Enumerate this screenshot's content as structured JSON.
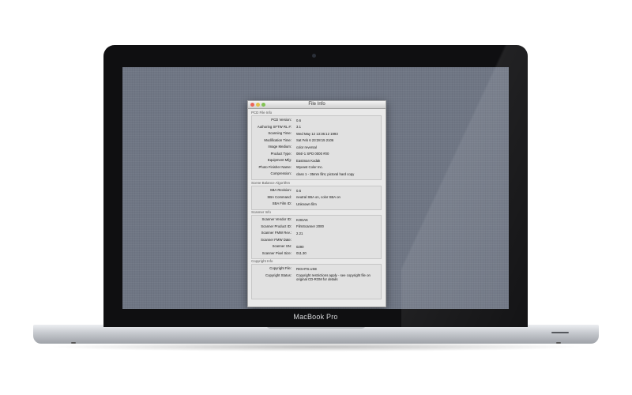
{
  "device": {
    "brand": "MacBook Pro"
  },
  "window": {
    "title": "File Info",
    "groups": {
      "pcd": {
        "label": "PCD File Info",
        "rows": [
          {
            "key": "PCD Version:",
            "value": "0.6"
          },
          {
            "key": "Authoring SFTW RL #:",
            "value": "3.1"
          },
          {
            "key": "Scanning Time:",
            "value": "Wed May 12 13:36:12 1993"
          },
          {
            "key": "Modification Time:",
            "value": "Sat Feb  6 23:28:15 2106"
          },
          {
            "key": "Image Medium:",
            "value": "color reversal"
          },
          {
            "key": "Product Type:",
            "value": "084/-1 SPD 0000 #00"
          },
          {
            "key": "Equipment Mfg:",
            "value": "Eastman Kodak"
          },
          {
            "key": "Photo Finisher Name:",
            "value": "Wyeast Color Inc."
          },
          {
            "key": "Compression:",
            "value": "class 1 - 35mm film; pictoral hard copy"
          }
        ]
      },
      "sba": {
        "label": "Scene Balance Algorithm",
        "rows": [
          {
            "key": "SBA Revision:",
            "value": "0.6"
          },
          {
            "key": "SBA Command:",
            "value": "neutral SBA on, color SBA on"
          },
          {
            "key": "SBA Film ID:",
            "value": "Unknown film"
          }
        ]
      },
      "scanner": {
        "label": "Scanner Info",
        "rows": [
          {
            "key": "Scanner Vendor ID:",
            "value": "KODAK"
          },
          {
            "key": "Scanner Product ID:",
            "value": "FilmScanner 2000"
          },
          {
            "key": "Scanner FMW Rev.:",
            "value": "2.21"
          },
          {
            "key": "Scanner FMW Date:",
            "value": ""
          },
          {
            "key": "Scanner SN:",
            "value": "0290"
          },
          {
            "key": "Scanner Pixel Size:",
            "value": "011.30"
          }
        ]
      },
      "copyright": {
        "label": "Copyright Info",
        "rows": [
          {
            "key": "Copyright File:",
            "value": "RIGHTS.USE"
          },
          {
            "key": "Copyright Status:",
            "value": "Copyright restrictions apply - see copyright file on original CD-ROM for details"
          }
        ]
      }
    }
  }
}
